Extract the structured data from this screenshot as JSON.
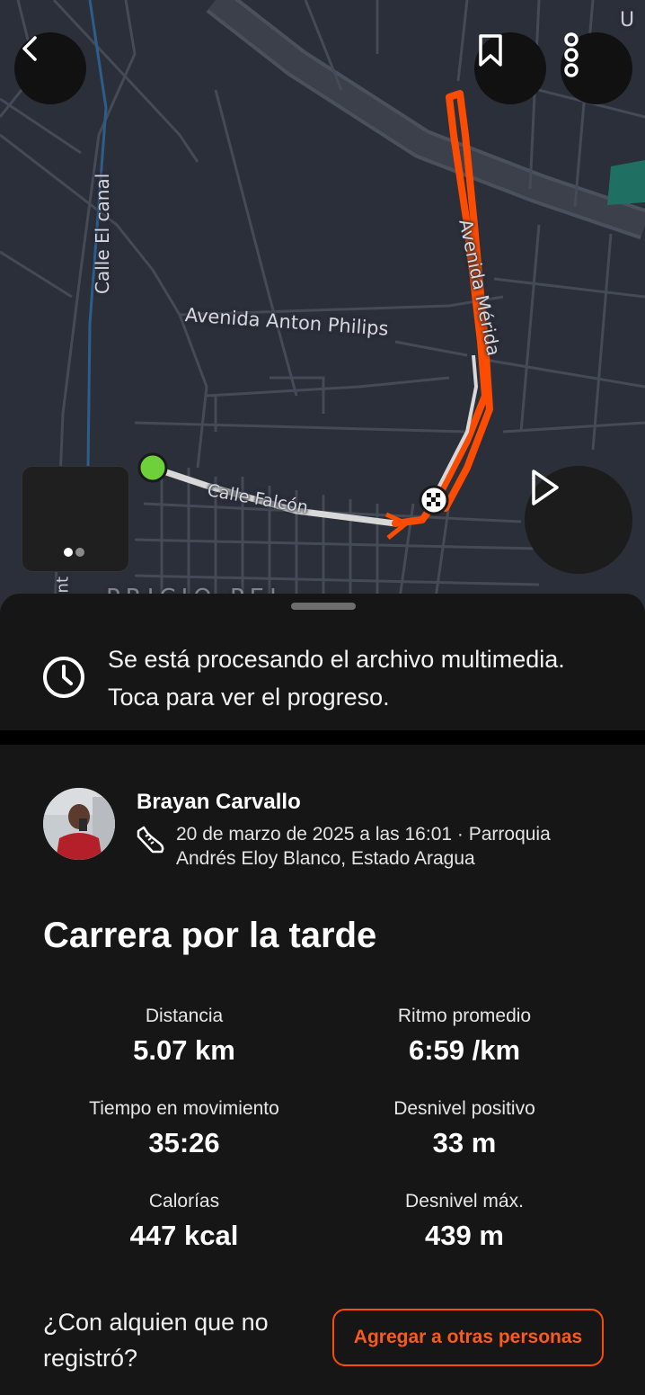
{
  "map": {
    "labels": {
      "calle_el_canal": "Calle El canal",
      "avenida_anton_philips": "Avenida Anton Philips",
      "avenida_merida": "Avenida Mérida",
      "calle_falcon": "Calle Falcón",
      "corner_text": "U",
      "side_text": "ant",
      "bottom_text": "PRICIO PEL"
    },
    "route_color": "#fc4c02",
    "start_marker_color": "#6fd13a",
    "media_carousel": {
      "page": 1,
      "total": 2
    }
  },
  "icons": {
    "back": "chevron-left-icon",
    "bookmark": "bookmark-icon",
    "more": "more-vertical-icon",
    "play": "play-icon",
    "clock": "clock-icon",
    "shoe": "running-shoe-icon"
  },
  "processing": {
    "message": "Se está procesando el archivo multimedia. Toca para ver el progreso."
  },
  "athlete": {
    "name": "Brayan Carvallo",
    "meta": "20 de marzo de 2025 a las 16:01 · Parroquia Andrés Eloy Blanco, Estado Aragua"
  },
  "activity": {
    "title": "Carrera por la tarde",
    "stats": [
      {
        "label": "Distancia",
        "value": "5.07 km"
      },
      {
        "label": "Ritmo promedio",
        "value": "6:59 /km"
      },
      {
        "label": "Tiempo en movimiento",
        "value": "35:26"
      },
      {
        "label": "Desnivel positivo",
        "value": "33 m"
      },
      {
        "label": "Calorías",
        "value": "447 kcal"
      },
      {
        "label": "Desnivel máx.",
        "value": "439 m"
      }
    ]
  },
  "tag_others": {
    "question": "¿Con alquien que no registró?",
    "button_label": "Agregar a otras personas"
  },
  "colors": {
    "accent": "#fc4c02",
    "background": "#161616",
    "map_background": "#2b2f3a"
  }
}
